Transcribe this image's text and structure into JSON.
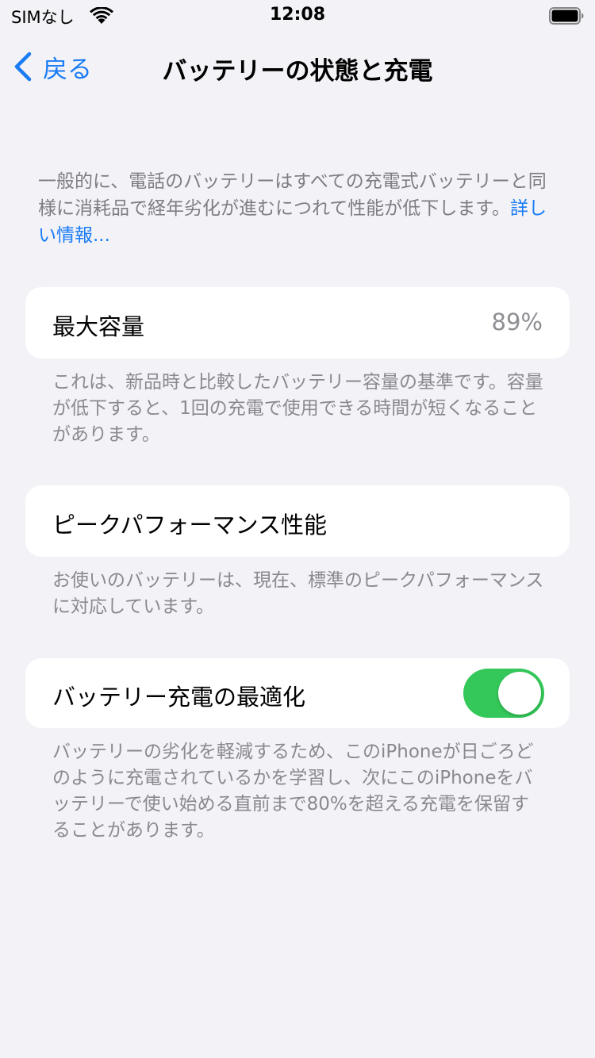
{
  "status_bar": {
    "carrier": "SIMなし",
    "time": "12:08"
  },
  "nav": {
    "back_label": "戻る",
    "title": "バッテリーの状態と充電"
  },
  "intro": {
    "text": "一般的に、電話のバッテリーはすべての充電式バッテリーと同様に消耗品で経年劣化が進むにつれて性能が低下します。",
    "link": "詳しい情報..."
  },
  "max_capacity": {
    "label": "最大容量",
    "value": "89%",
    "footer": "これは、新品時と比較したバッテリー容量の基準です。容量が低下すると、1回の充電で使用できる時間が短くなることがあります。"
  },
  "peak_performance": {
    "label": "ピークパフォーマンス性能",
    "footer": "お使いのバッテリーは、現在、標準のピークパフォーマンスに対応しています。"
  },
  "optimized_charging": {
    "label": "バッテリー充電の最適化",
    "enabled": true,
    "toggle_color": "#34c759",
    "footer": "バッテリーの劣化を軽減するため、このiPhoneが日ごろどのように充電されているかを学習し、次にこのiPhoneをバッテリーで使い始める直前まで80%を超える充電を保留することがあります。"
  },
  "colors": {
    "accent": "#1a7cf5",
    "background": "#f2f2f7"
  },
  "icons": {
    "wifi": "wifi-icon",
    "battery": "battery-icon",
    "back": "chevron-left-icon"
  }
}
